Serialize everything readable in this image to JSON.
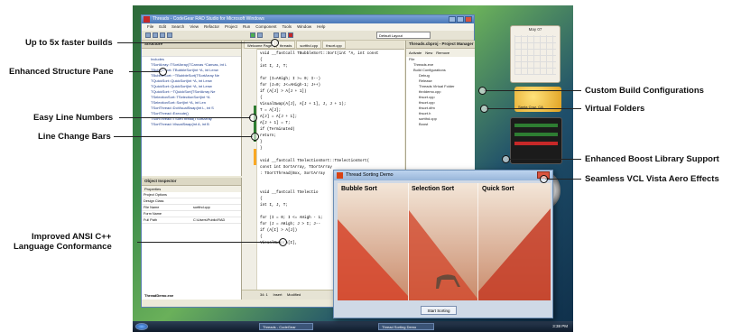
{
  "callouts_left": [
    {
      "id": "builds",
      "text": "Up to 5x faster builds"
    },
    {
      "id": "structure",
      "text": "Enhanced Structure Pane"
    },
    {
      "id": "lines",
      "text": "Easy Line Numbers"
    },
    {
      "id": "changebars",
      "text": "Line Change Bars"
    },
    {
      "id": "ansi1",
      "text": "Improved ANSI C++"
    },
    {
      "id": "ansi2",
      "text": "Language Conformance"
    }
  ],
  "callouts_right": [
    {
      "id": "config",
      "text": "Custom Build Configurations"
    },
    {
      "id": "folders",
      "text": "Virtual Folders"
    },
    {
      "id": "boost",
      "text": "Enhanced Boost Library Support"
    },
    {
      "id": "vcl",
      "text": "Seamless VCL Vista Aero Effects"
    }
  ],
  "ide": {
    "title": "Threads - CodeGear RAD Studio for Microsoft Windows",
    "menu": [
      "File",
      "Edit",
      "Search",
      "View",
      "Refactor",
      "Project",
      "Run",
      "Component",
      "Tools",
      "Window",
      "Help"
    ],
    "layout": "Default Layout",
    "structure_title": "Structure",
    "structure_items": [
      "Includes",
      "TSortArray::TSortArray(TCanvas *Canvas, int L",
      "TBubbleSort::TBubbleSort(int *A, int Lenw",
      "TBubbleSort::~TBubbleSort(TSortArray Ne",
      "TQuickSort::QuickSort(int *A, int Lenw",
      "TQuickSort::QuickSort(int *A, int Lenw",
      "TQuickSort::~TQuickSort(TSortArray Ne",
      "TSelectionSort::TSelectionSort(int *A",
      "TSelectionSort::Sort(int *A, int Len",
      "TSortThread::DoVisualSwap(int L, int S",
      "TSortThread::Execute()",
      "TSortThread::TSortThread(TSortArray",
      "TSortThread::VisualSwap(int A, int B"
    ],
    "inspector_title": "Object Inspector",
    "inspector_tab": "Properties",
    "inspector_rows": [
      [
        "Project Options",
        ""
      ],
      [
        "Design Class",
        ""
      ],
      [
        "File Name",
        "sortthd.cpp"
      ],
      [
        "Form Name",
        ""
      ],
      [
        "Full Path",
        "C:\\Users\\Public\\RAD"
      ]
    ],
    "inspector_footer": "ThreadDemo.exe",
    "tabs": [
      "Welcome Page",
      "threads",
      "sortthd.cpp",
      "thsort.cpp"
    ],
    "code": [
      "void __fastcall TBubbleSort::Sort(int *A, int const",
      "{",
      "  int I, J, T;",
      "",
      "  for (I=AHigh; I >= 0; I--)",
      "    for (J=0; J<=AHigh-1; J++)",
      "      if (A[J] > A[J + 1])",
      "      {",
      "        VisualSwap(A[J], A[J + 1], J, J + 1);",
      "        T = A[J];",
      "        A[J] = A[J + 1];",
      "        A[J + 1] = T;",
      "        if (Terminated)",
      "          return;",
      "      }",
      "}",
      "",
      "void __fastcall TSelectionSort::TSelectionSort(",
      "  const int SortArray, TSortArray",
      "  : TSortThread(Box, SortArray",
      "",
      "",
      "void __fastcall TSelectio",
      "{",
      "  int I, J, T;",
      "",
      "  for (I = 0; I <= AHigh - 1;",
      "    for (J = AHigh; J > I; J--",
      "      if (A[I] > A[J])",
      "      {",
      "        VisualSwap(A[I],"
    ],
    "status": [
      "34: 1",
      "Insert",
      "Modified"
    ],
    "pm_title": "Threads.cbproj - Project Manager",
    "pm_buttons": [
      "Activate",
      "New",
      "Remove"
    ],
    "pm_items": [
      "File",
      "Threads.exe",
      "Build Configurations",
      "Debug",
      "Release",
      "Threads Virtual Folder",
      "thrddemo.cpp",
      "thsort.cpp",
      "thsort.cpp",
      "thsort.dfm",
      "thsort.h",
      "sortthd.cpp",
      "Boost",
      "",
      ""
    ]
  },
  "thread_window": {
    "title": "Thread Sorting Demo",
    "columns": [
      "Bubble Sort",
      "Selection Sort",
      "Quick Sort"
    ],
    "button": "Start Sorting"
  },
  "taskbar": {
    "items": [
      "Threads - CodeGear",
      "Thread Sorting Demo"
    ],
    "clock": "3:38 PM"
  },
  "sidebar": {
    "month": "May 07",
    "weather": "Santa Cruz, CA"
  }
}
